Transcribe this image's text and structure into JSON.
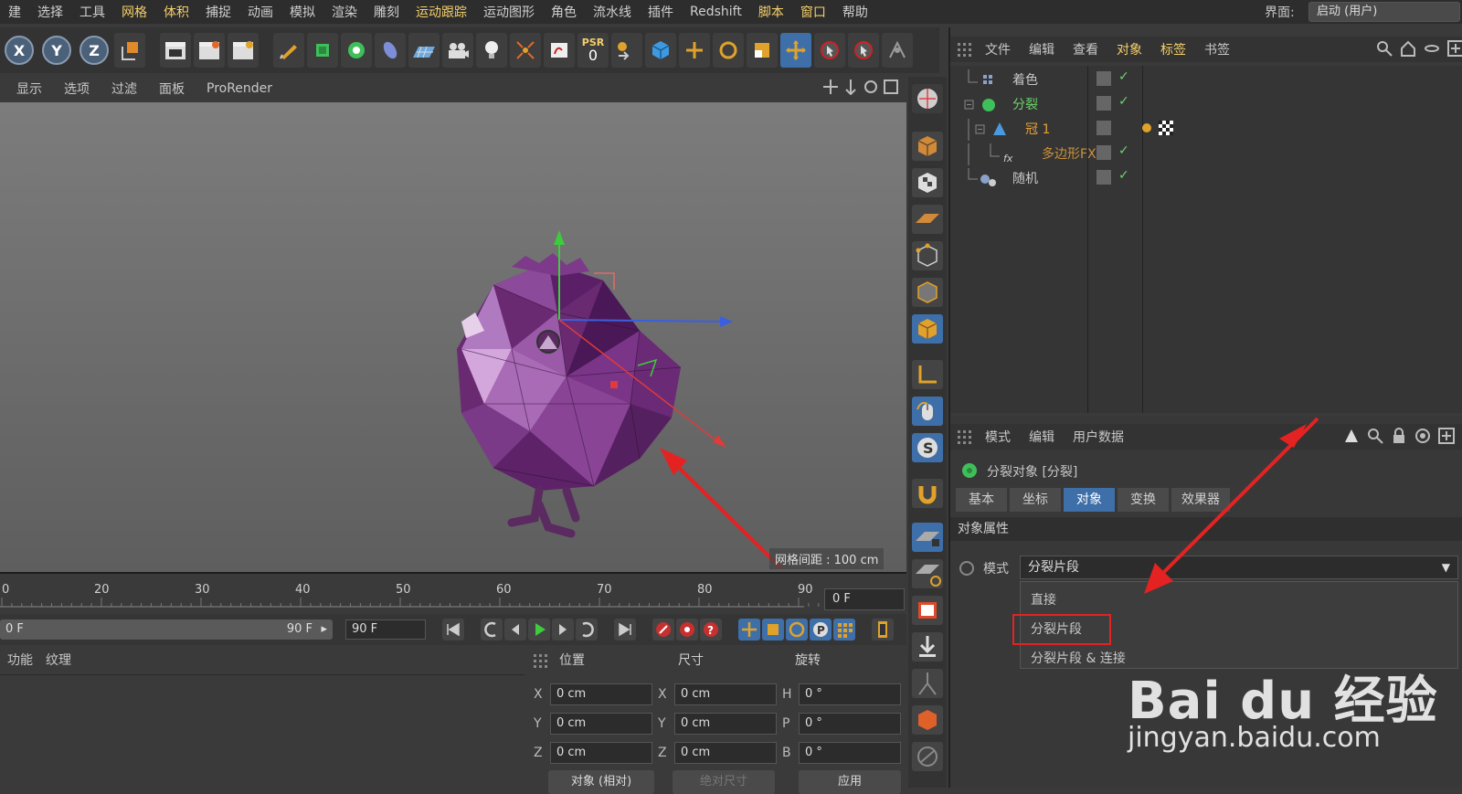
{
  "menubar": {
    "items": [
      "建",
      "选择",
      "工具",
      "网格",
      "体积",
      "捕捉",
      "动画",
      "模拟",
      "渲染",
      "雕刻",
      "运动跟踪",
      "运动图形",
      "角色",
      "流水线",
      "插件",
      "Redshift",
      "脚本",
      "窗口",
      "帮助"
    ],
    "layout_label": "界面:",
    "layout_value": "启动 (用户)"
  },
  "toolbar": {
    "axis_x": "X",
    "axis_y": "Y",
    "axis_z": "Z",
    "psr_label": "PSR",
    "psr_value": "0"
  },
  "viewport": {
    "menu": [
      "",
      "显示",
      "选项",
      "过滤",
      "面板",
      "ProRender"
    ],
    "grid_info": "网格间距 : 100 cm"
  },
  "timeline": {
    "ticks": [
      "0",
      "20",
      "30",
      "40",
      "50",
      "60",
      "70",
      "80",
      "90"
    ],
    "current_frame": "0 F",
    "range_start": "0 F",
    "range_end": "90 F",
    "end_frame": "90 F"
  },
  "materials": {
    "tabs": [
      "功能",
      "纹理"
    ]
  },
  "coords": {
    "position_label": "位置",
    "size_label": "尺寸",
    "rotation_label": "旋转",
    "pos": [
      {
        "axis": "X",
        "value": "0 cm"
      },
      {
        "axis": "Y",
        "value": "0 cm"
      },
      {
        "axis": "Z",
        "value": "0 cm"
      }
    ],
    "size": [
      {
        "axis": "X",
        "value": "0 cm"
      },
      {
        "axis": "Y",
        "value": "0 cm"
      },
      {
        "axis": "Z",
        "value": "0 cm"
      }
    ],
    "rot": [
      {
        "axis": "H",
        "value": "0 °"
      },
      {
        "axis": "P",
        "value": "0 °"
      },
      {
        "axis": "B",
        "value": "0 °"
      }
    ],
    "mode_btn": "对象 (相对)",
    "size_btn": "绝对尺寸",
    "apply_btn": "应用"
  },
  "object_manager": {
    "menu": [
      "文件",
      "编辑",
      "查看",
      "对象",
      "标签",
      "书签"
    ],
    "rows": [
      {
        "name": "着色",
        "color": "gray"
      },
      {
        "name": "分裂",
        "color": "green"
      },
      {
        "name": "冠 1",
        "color": "orange"
      },
      {
        "name": "多边形FX",
        "color": "orange"
      },
      {
        "name": "随机",
        "color": "gray"
      }
    ]
  },
  "attributes": {
    "menu": [
      "模式",
      "编辑",
      "用户数据"
    ],
    "title": "分裂对象 [分裂]",
    "tabs": [
      "基本",
      "坐标",
      "对象",
      "变换",
      "效果器"
    ],
    "active_tab": "对象",
    "section": "对象属性",
    "mode_label": "模式",
    "mode_value": "分裂片段",
    "options": [
      "直接",
      "分裂片段",
      "分裂片段 & 连接"
    ]
  },
  "watermark": {
    "brand": "Bai du 经验",
    "url": "jingyan.baidu.com"
  },
  "colors": {
    "accent_blue": "#3e6fa8",
    "highlight_red": "#e02424",
    "menu_highlight": "#f5d06a"
  }
}
